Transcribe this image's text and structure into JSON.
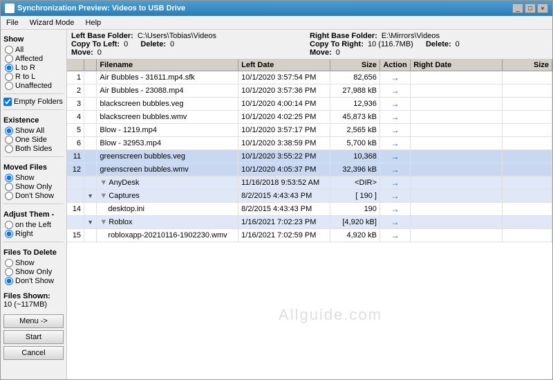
{
  "window": {
    "title": "Synchronization Preview: Videos to USB Drive",
    "controls": [
      "_",
      "□",
      "×"
    ]
  },
  "menu": {
    "items": [
      "File",
      "Wizard Mode",
      "Help"
    ]
  },
  "left_panel": {
    "show_label": "Show",
    "show_options": [
      {
        "label": "All",
        "checked": false
      },
      {
        "label": "Affected",
        "checked": false
      },
      {
        "label": "L to R",
        "checked": true
      },
      {
        "label": "R to L",
        "checked": false
      },
      {
        "label": "Unaffected",
        "checked": false
      }
    ],
    "empty_folders_label": "Empty Folders",
    "empty_folders_checked": true,
    "existence_label": "Existence",
    "existence_options": [
      {
        "label": "Show All",
        "checked": true
      },
      {
        "label": "One Side",
        "checked": false
      },
      {
        "label": "Both Sides",
        "checked": false
      }
    ],
    "moved_files_label": "Moved Files",
    "moved_options": [
      {
        "label": "Show",
        "checked": true
      },
      {
        "label": "Show Only",
        "checked": false
      },
      {
        "label": "Don't Show",
        "checked": false
      }
    ],
    "adjust_them_label": "Adjust Them -",
    "adjust_options": [
      {
        "label": "on the Left",
        "checked": false
      },
      {
        "label": "Right",
        "checked": true
      }
    ],
    "files_to_delete_label": "Files To Delete",
    "delete_options": [
      {
        "label": "Show",
        "checked": false
      },
      {
        "label": "Show Only",
        "checked": false
      },
      {
        "label": "Don't Show",
        "checked": true
      }
    ]
  },
  "info_bar": {
    "left_base_folder_label": "Left Base Folder:",
    "left_base_folder_value": "C:\\Users\\Tobias\\Videos",
    "right_base_folder_label": "Right Base Folder:",
    "right_base_folder_value": "E:\\Mirrors\\Videos",
    "copy_to_left_label": "Copy To Left:",
    "copy_to_left_value": "0",
    "copy_to_right_label": "Copy To Right:",
    "copy_to_right_value": "10 (116.7MB)",
    "move_left_label": "Move:",
    "move_left_value": "0",
    "move_left_delete_label": "Delete:",
    "move_left_delete_value": "0",
    "move_right_label": "Move:",
    "move_right_value": "0",
    "move_right_delete_label": "Delete:",
    "move_right_delete_value": "0"
  },
  "table": {
    "headers": [
      "",
      "",
      "Filename",
      "Left Date",
      "Size",
      "Action",
      "Right Date",
      "Size"
    ],
    "rows": [
      {
        "num": "1",
        "expand": "",
        "filename": "Air Bubbles - 31611.mp4.sfk",
        "leftdate": "10/1/2020 3:57:54 PM",
        "size": "82,656",
        "action": "→",
        "rightdate": "",
        "rightsize": "",
        "highlight": false,
        "indent": false,
        "dir": false
      },
      {
        "num": "2",
        "expand": "",
        "filename": "Air Bubbles - 23088.mp4",
        "leftdate": "10/1/2020 3:57:36 PM",
        "size": "27,988 kB",
        "action": "→",
        "rightdate": "",
        "rightsize": "",
        "highlight": false,
        "indent": false,
        "dir": false
      },
      {
        "num": "3",
        "expand": "",
        "filename": "blackscreen bubbles.veg",
        "leftdate": "10/1/2020 4:00:14 PM",
        "size": "12,936",
        "action": "→",
        "rightdate": "",
        "rightsize": "",
        "highlight": false,
        "indent": false,
        "dir": false
      },
      {
        "num": "4",
        "expand": "",
        "filename": "blackscreen bubbles.wmv",
        "leftdate": "10/1/2020 4:02:25 PM",
        "size": "45,873 kB",
        "action": "→",
        "rightdate": "",
        "rightsize": "",
        "highlight": false,
        "indent": false,
        "dir": false
      },
      {
        "num": "5",
        "expand": "",
        "filename": "Blow - 1219.mp4",
        "leftdate": "10/1/2020 3:57:17 PM",
        "size": "2,565 kB",
        "action": "→",
        "rightdate": "",
        "rightsize": "",
        "highlight": false,
        "indent": false,
        "dir": false
      },
      {
        "num": "6",
        "expand": "",
        "filename": "Blow - 32953.mp4",
        "leftdate": "10/1/2020 3:38:59 PM",
        "size": "5,700 kB",
        "action": "→",
        "rightdate": "",
        "rightsize": "",
        "highlight": false,
        "indent": false,
        "dir": false
      },
      {
        "num": "11",
        "expand": "",
        "filename": "greenscreen bubbles.veg",
        "leftdate": "10/1/2020 3:55:22 PM",
        "size": "10,368",
        "action": "→",
        "rightdate": "",
        "rightsize": "",
        "highlight": true,
        "indent": false,
        "dir": false
      },
      {
        "num": "12",
        "expand": "",
        "filename": "greenscreen bubbles.wmv",
        "leftdate": "10/1/2020 4:05:37 PM",
        "size": "32,396 kB",
        "action": "→",
        "rightdate": "",
        "rightsize": "",
        "highlight": true,
        "indent": false,
        "dir": false
      },
      {
        "num": "",
        "expand": "",
        "filename": "AnyDesk",
        "leftdate": "11/16/2018 9:53:52 AM",
        "size": "<DIR>",
        "action": "→",
        "rightdate": "",
        "rightsize": "",
        "highlight": false,
        "indent": false,
        "dir": true
      },
      {
        "num": "",
        "expand": "▼",
        "filename": "Captures",
        "leftdate": "8/2/2015 4:43:43 PM",
        "size": "[ 190 ]",
        "action": "→",
        "rightdate": "",
        "rightsize": "",
        "highlight": false,
        "indent": false,
        "dir": true
      },
      {
        "num": "14",
        "expand": "",
        "filename": "desktop.ini",
        "leftdate": "8/2/2015 4:43:43 PM",
        "size": "190",
        "action": "→",
        "rightdate": "",
        "rightsize": "",
        "highlight": false,
        "indent": true,
        "dir": false
      },
      {
        "num": "",
        "expand": "▼",
        "filename": "Roblox",
        "leftdate": "1/16/2021 7:02:23 PM",
        "size": "[4,920 kB]",
        "action": "→",
        "rightdate": "",
        "rightsize": "",
        "highlight": false,
        "indent": false,
        "dir": true
      },
      {
        "num": "15",
        "expand": "",
        "filename": "robloxapp-20210116-1902230.wmv",
        "leftdate": "1/16/2021 7:02:59 PM",
        "size": "4,920 kB",
        "action": "→",
        "rightdate": "",
        "rightsize": "",
        "highlight": false,
        "indent": true,
        "dir": false
      }
    ]
  },
  "bottom": {
    "files_shown_label": "Files Shown:",
    "files_shown_value": "10 (~117MB)",
    "menu_btn": "Menu ->",
    "start_btn": "Start",
    "cancel_btn": "Cancel"
  },
  "watermark": "Allguide.com"
}
